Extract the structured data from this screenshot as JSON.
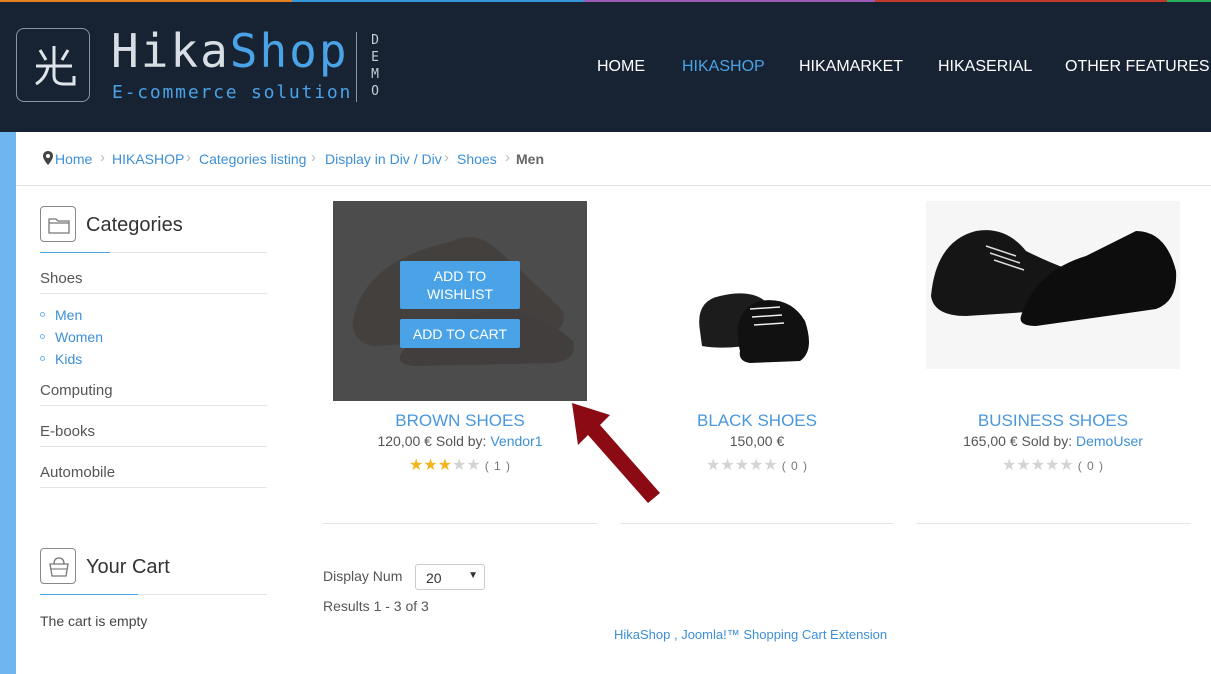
{
  "colors": {
    "header_bg": "#172332",
    "accent": "#4aa3e6",
    "link": "#3d8fd7",
    "annotation_arrow": "#8b0a14",
    "top_stripe": [
      "#e67e22",
      "#3498db",
      "#9b59b6",
      "#c0392b",
      "#27ae60"
    ]
  },
  "header": {
    "brand_part1": "Hika",
    "brand_part2": "Shop",
    "tagline": "E-commerce solution",
    "demo_label": "DEMO",
    "logo_icon": "hikashop-logo-icon"
  },
  "nav": {
    "items": [
      {
        "label": "HOME",
        "active": false
      },
      {
        "label": "HIKASHOP",
        "active": true
      },
      {
        "label": "HIKAMARKET",
        "active": false
      },
      {
        "label": "HIKASERIAL",
        "active": false
      },
      {
        "label": "OTHER FEATURES",
        "active": false
      }
    ]
  },
  "breadcrumb": {
    "icon": "map-pin-icon",
    "items": [
      "Home",
      "HIKASHOP",
      "Categories listing",
      "Display in Div / Div",
      "Shoes",
      "Men"
    ]
  },
  "categories": {
    "title": "Categories",
    "icon": "folder-icon",
    "items": [
      {
        "label": "Shoes",
        "children": [
          "Men",
          "Women",
          "Kids"
        ]
      },
      {
        "label": "Computing"
      },
      {
        "label": "E-books"
      },
      {
        "label": "Automobile"
      }
    ]
  },
  "cart": {
    "title": "Your Cart",
    "icon": "basket-icon",
    "empty_text": "The cart is empty"
  },
  "products": [
    {
      "name": "BROWN SHOES",
      "price": "120,00 €",
      "sold_by_label": " Sold by: ",
      "vendor": "Vendor1",
      "rating": 3,
      "rating_count": "( 1 )",
      "wishlist_label": "ADD TO WISHLIST",
      "cart_label": "ADD TO CART",
      "hovered": true
    },
    {
      "name": "BLACK SHOES",
      "price": "150,00 €",
      "sold_by_label": "",
      "vendor": "",
      "rating": 0,
      "rating_count": "( 0 )"
    },
    {
      "name": "BUSINESS SHOES",
      "price": "165,00 €",
      "sold_by_label": " Sold by: ",
      "vendor": "DemoUser",
      "rating": 0,
      "rating_count": "( 0 )"
    }
  ],
  "pagination": {
    "display_label": "Display Num",
    "display_value": "20",
    "results_text": "Results 1 - 3 of 3"
  },
  "footer": {
    "link_text": "HikaShop , Joomla!™ Shopping Cart Extension"
  }
}
